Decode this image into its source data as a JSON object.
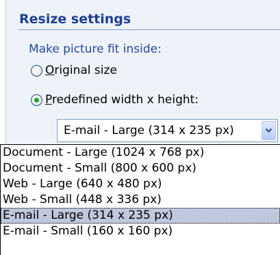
{
  "section": {
    "title": "Resize settings"
  },
  "fit": {
    "label": "Make picture fit inside:"
  },
  "options": {
    "original": {
      "accel": "O",
      "rest": "riginal size",
      "checked": false
    },
    "predefined": {
      "accel": "P",
      "rest": "redefined width x height:",
      "checked": true
    }
  },
  "combo": {
    "value": "E-mail - Large (314 x 235 px)"
  },
  "dropdown": {
    "items": [
      "Document - Large (1024 x 768 px)",
      "Document - Small (800 x 600 px)",
      "Web - Large (640 x 480 px)",
      "Web - Small (448 x 336 px)",
      "E-mail - Large (314 x 235 px)",
      "E-mail - Small (160 x 160 px)"
    ],
    "selected_index": 4
  },
  "colors": {
    "header_text": "#1e3f8c",
    "label_text": "#28469a",
    "pane_bg": "#eef3fa",
    "radio_dot": "#21a121",
    "selection_bg": "#bfc7dc"
  },
  "icons": {
    "combo_arrow": "chevron-down-icon"
  }
}
